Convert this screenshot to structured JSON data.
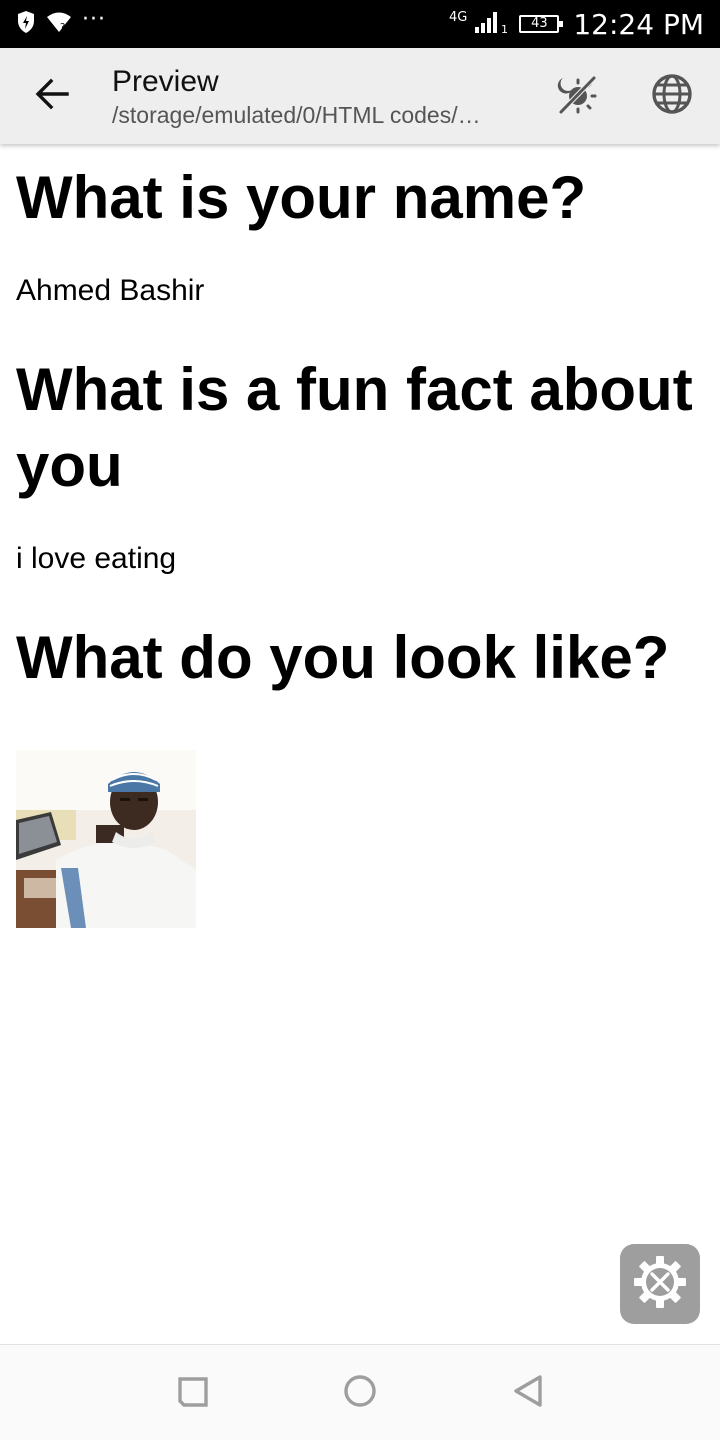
{
  "status_bar": {
    "network": "4G",
    "sim_slot": "1",
    "battery": "43",
    "time": "12:24 PM",
    "overflow": "···"
  },
  "app_bar": {
    "title": "Preview",
    "subtitle": "/storage/emulated/0/HTML codes/…"
  },
  "content": {
    "q1": "What is your name?",
    "a1": "Ahmed Bashir",
    "q2": "What is a fun fact about you",
    "a2": "i love eating",
    "q3": "What do you look like?"
  },
  "colors": {
    "status_bar": "#000000",
    "app_bar": "#eeeeee",
    "fab": "#9e9e9e",
    "nav_icons": "#9e9e9e"
  },
  "icons": {
    "back": "arrow-left-icon",
    "mode": "theme-toggle-icon",
    "globe": "globe-icon",
    "fab": "settings-tools-icon",
    "nav_recent": "square-icon",
    "nav_home": "circle-icon",
    "nav_back": "triangle-icon"
  }
}
